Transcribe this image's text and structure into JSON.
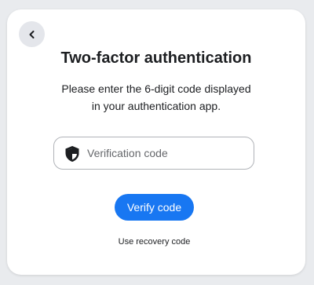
{
  "header": {
    "back_icon": "chevron-left-icon",
    "title": "Two-factor authentication"
  },
  "main": {
    "description_line1": "Please enter the 6-digit code displayed",
    "description_line2": "in your authentication app."
  },
  "form": {
    "shield_icon": "shield-icon",
    "code_placeholder": "Verification code",
    "code_value": "",
    "verify_label": "Verify code",
    "recovery_label": "Use recovery code"
  },
  "colors": {
    "accent": "#1877f2",
    "background": "#e9ebee",
    "card": "#ffffff",
    "text": "#1c1e21"
  }
}
